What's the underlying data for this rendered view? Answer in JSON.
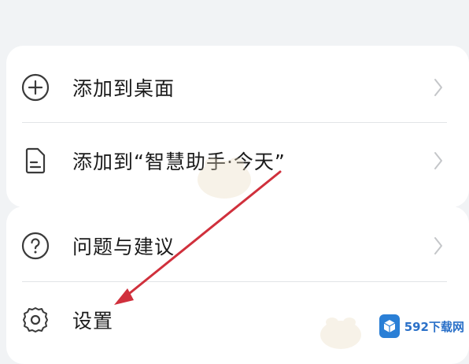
{
  "menu": {
    "items": [
      {
        "label": "添加到桌面",
        "icon": "add-circle-icon",
        "has_chevron": true
      },
      {
        "label": "添加到“智慧助手·今天”",
        "icon": "document-icon",
        "has_chevron": true
      },
      {
        "label": "问题与建议",
        "icon": "help-circle-icon",
        "has_chevron": true
      },
      {
        "label": "设置",
        "icon": "gear-icon",
        "has_chevron": false
      }
    ]
  },
  "annotation": {
    "arrow_color": "#d0303c"
  },
  "watermark": {
    "text": "592下载网"
  }
}
